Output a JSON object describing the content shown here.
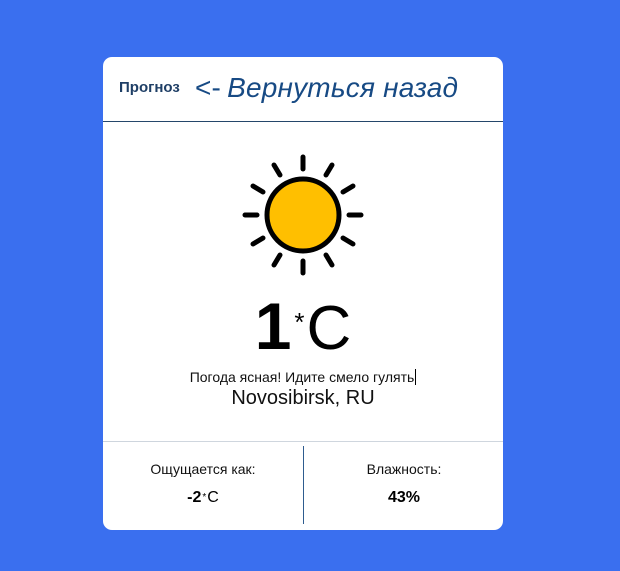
{
  "header": {
    "title": "Прогноз",
    "back_arrow": "<-",
    "back_label": "Вернуться назад"
  },
  "weather": {
    "icon": "sun-icon",
    "temperature": "1",
    "degree_symbol": "*",
    "unit": "C",
    "description": "Погода ясная! Идите смело гулять",
    "location": "Novosibirsk, RU"
  },
  "feels_like": {
    "label": "Ощущается как:",
    "value": "-2",
    "degree_symbol": "*",
    "unit": "C"
  },
  "humidity": {
    "label": "Влажность:",
    "value": "43%"
  },
  "colors": {
    "background": "#3a6fef",
    "card": "#ffffff",
    "sun": "#ffbf00",
    "link": "#174a84"
  }
}
